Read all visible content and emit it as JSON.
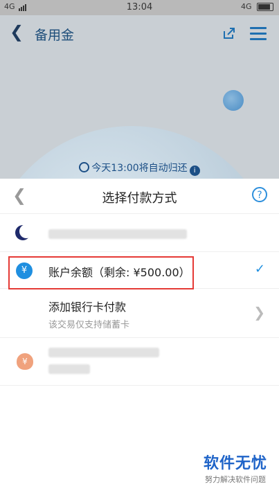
{
  "status_bar": {
    "network_left": "4G",
    "time": "13:04",
    "network_right": "4G"
  },
  "app": {
    "title": "备用金",
    "auto_return_text": "今天13:00将自动归还"
  },
  "sheet": {
    "title": "选择付款方式",
    "help_label": "?",
    "items": [
      {
        "label": "账户余额（剩余: ¥500.00）",
        "icon": "yen-icon",
        "selected": true
      },
      {
        "label": "添加银行卡付款",
        "note": "该交易仅支持储蓄卡",
        "icon": "chevron-right-icon"
      }
    ]
  },
  "watermark": {
    "title": "软件无忧",
    "subtitle": "努力解决软件问题"
  },
  "colors": {
    "accent": "#1f8fe0",
    "highlight_box": "#e53935"
  }
}
